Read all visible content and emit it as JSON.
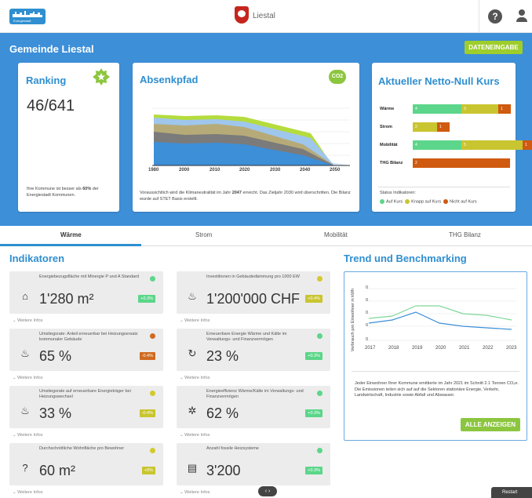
{
  "header": {
    "logo_text": "Energiestadt",
    "town": "Liestal",
    "help_icon": "question-circle-icon",
    "user_icon": "user-icon"
  },
  "municipality": {
    "title": "Gemeinde Liestal",
    "data_entry_button": "DATENEINGABE"
  },
  "ranking": {
    "title": "Ranking",
    "value": "46/641",
    "note_prefix": "Ihre Kommune ist besser als ",
    "note_pct": "60%",
    "note_suffix": " der Energiestadt Kommunen."
  },
  "absenkpfad": {
    "title": "Absenkpfad",
    "note_a": "Voraussichtlich wird die Klimaneutralität im Jahr ",
    "year": "2047",
    "note_b": " erreicht. Das Zieljahr 2030 wird überschritten. Die Bilanz wurde auf STET Basis erstellt.",
    "xticks": [
      "1980",
      "2000",
      "2010",
      "2020",
      "2030",
      "2040",
      "2050"
    ],
    "co2_badge": "CO2"
  },
  "netto_null": {
    "title": "Aktueller Netto-Null Kurs",
    "rows": [
      {
        "label": "Wärme",
        "green": 4,
        "yellow": 3,
        "red": 1
      },
      {
        "label": "Strom",
        "green": 0,
        "yellow": 2,
        "red": 1
      },
      {
        "label": "Mobilität",
        "green": 4,
        "yellow": 5,
        "red": 1
      },
      {
        "label": "THG Bilanz",
        "green": 0,
        "yellow": 0,
        "red": 2
      }
    ],
    "status_title": "Status Indikatoren:",
    "status_on": "Auf Kurs",
    "status_near": "Knapp auf Kurs",
    "status_off": "Nicht auf Kurs",
    "colors": {
      "green": "#5cd68a",
      "yellow": "#c9c530",
      "red": "#cf5a10"
    }
  },
  "tabs": [
    "Wärme",
    "Strom",
    "Mobilität",
    "THG Bilanz"
  ],
  "indicators_title": "Indikatoren",
  "indicators": [
    {
      "label": "Energiebezugsfläche mit Minergie P und A Standard",
      "value": "1'280 m²",
      "pct": "+0.3%",
      "status": "#5cd68a",
      "pctcolor": "#5cd68a",
      "icon": "house-icon",
      "glyph": "⌂"
    },
    {
      "label": "Investitionen in Gebäudedämmung pro 1000 EW",
      "value": "1'200'000 CHF",
      "pct": "+0.4%",
      "status": "#d4c92e",
      "pctcolor": "#c9c530",
      "icon": "heating-money-icon",
      "glyph": "♨"
    },
    {
      "label": "Umstiegsrate: Anteil erneuerbar bei Heizungsersatz kommunaler Gebäude",
      "value": "65 %",
      "pct": "-0.4%",
      "status": "#d06a1e",
      "pctcolor": "#d06a1e",
      "icon": "heat-exchange-icon",
      "glyph": "♨"
    },
    {
      "label": "Erneuerbare Energie Wärme und Kälte im Verwaltungs- und Finanzvermögen",
      "value": "23 %",
      "pct": "+0.3%",
      "status": "#5cd68a",
      "pctcolor": "#5cd68a",
      "icon": "renewable-cycle-icon",
      "glyph": "↻"
    },
    {
      "label": "Umstiegsrate auf erneuerbare Energieträger bei Heizungswechsel",
      "value": "33 %",
      "pct": "-0.4%",
      "status": "#d4c92e",
      "pctcolor": "#c9c530",
      "icon": "heat-exchange-icon",
      "glyph": "♨"
    },
    {
      "label": "Energieeffizienz Wärme/Kälte im Verwaltungs- und Finanzvermögen",
      "value": "62 %",
      "pct": "+0.3%",
      "status": "#5cd68a",
      "pctcolor": "#5cd68a",
      "icon": "efficiency-gear-icon",
      "glyph": "✲"
    },
    {
      "label": "Durchschnittliche Wohnfläche pro Bewohner",
      "value": "60 m²",
      "pct": "+0%",
      "status": "#d4c92e",
      "pctcolor": "#c9c530",
      "icon": "house-question-icon",
      "glyph": "?"
    },
    {
      "label": "Anzahl fossile Heizsysteme",
      "value": "3'200",
      "pct": "+0.3%",
      "status": "#5cd68a",
      "pctcolor": "#5cd68a",
      "icon": "radiator-icon",
      "glyph": "▤"
    }
  ],
  "more_info": "Weitere Infos",
  "trend": {
    "title": "Trend und Benchmarking",
    "ylabel": "Verbrauch pro Einwohner in kWh",
    "xticks": [
      "2017",
      "2018",
      "2019",
      "2020",
      "2021",
      "2022",
      "2023"
    ],
    "yticks": [
      "0",
      "0",
      "0",
      "0",
      "0"
    ],
    "text_a": "Jeder Einwohner Ihrer Kommune emittierte im Jahr 2021 im Schnitt 2.1 Tonnen CO₂e. Die Emissionen teilen sich auf auf die Sektoren stationäre Energie, Verkehr, Landwirtschaft, Industrie sowie Abfall und Abwasser.",
    "button": "ALLE ANZEIGEN"
  },
  "pager": "‹ ›",
  "restart": "Restart"
}
